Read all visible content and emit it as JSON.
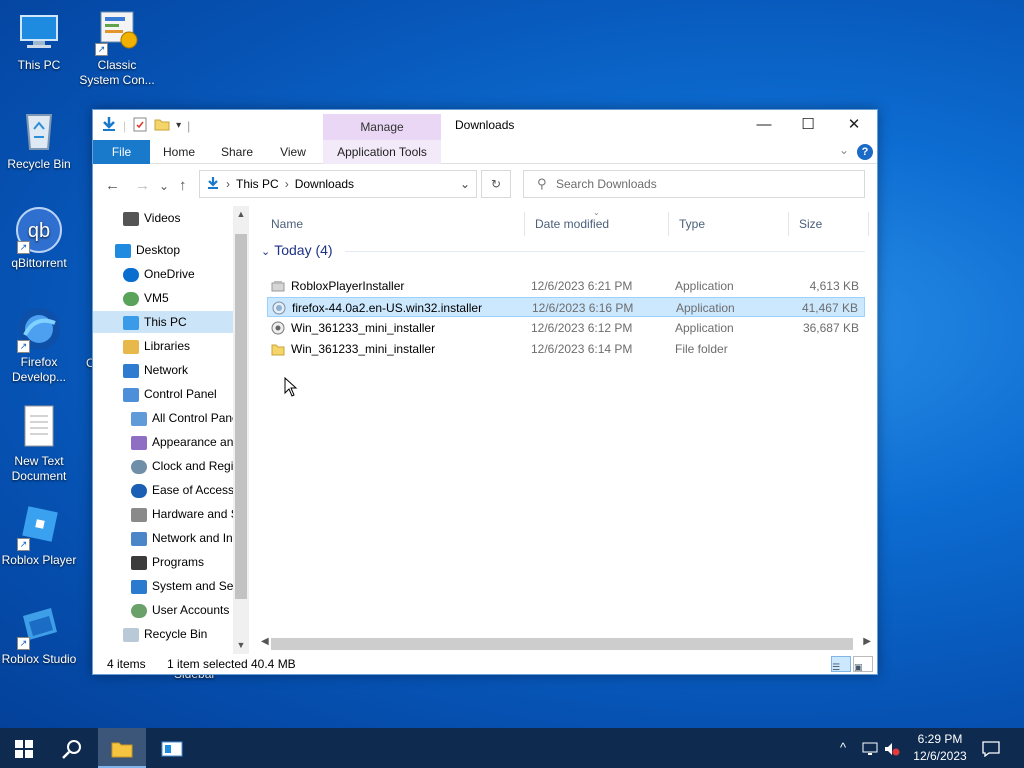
{
  "desktop": {
    "icons": [
      {
        "label": "This PC"
      },
      {
        "label": "Classic System Con..."
      },
      {
        "label": "Recycle Bin"
      },
      {
        "label": "qBittorrent"
      },
      {
        "label": "Firefox Develop..."
      },
      {
        "label": "New Text Document"
      },
      {
        "label": "Roblox Player"
      },
      {
        "label": "Roblox Studio"
      }
    ],
    "partial_label_1": "C",
    "partial_label_2": "Sidebar"
  },
  "window": {
    "title": "Downloads",
    "manage_tab": "Manage",
    "ribbon_tabs": {
      "file": "File",
      "home": "Home",
      "share": "Share",
      "view": "View",
      "app_tools": "Application Tools"
    },
    "address": {
      "crumb1": "This PC",
      "crumb2": "Downloads"
    },
    "search_placeholder": "Search Downloads",
    "nav_pane": [
      {
        "label": "Videos"
      },
      {
        "label": "Desktop"
      },
      {
        "label": "OneDrive"
      },
      {
        "label": "VM5"
      },
      {
        "label": "This PC"
      },
      {
        "label": "Libraries"
      },
      {
        "label": "Network"
      },
      {
        "label": "Control Panel"
      },
      {
        "label": "All Control Panel Items"
      },
      {
        "label": "Appearance and Personalization"
      },
      {
        "label": "Clock and Region"
      },
      {
        "label": "Ease of Access"
      },
      {
        "label": "Hardware and Sound"
      },
      {
        "label": "Network and Internet"
      },
      {
        "label": "Programs"
      },
      {
        "label": "System and Security"
      },
      {
        "label": "User Accounts"
      },
      {
        "label": "Recycle Bin"
      }
    ],
    "columns": {
      "name": "Name",
      "date": "Date modified",
      "type": "Type",
      "size": "Size"
    },
    "group_header": "Today (4)",
    "files": [
      {
        "name": "RobloxPlayerInstaller",
        "date": "12/6/2023 6:21 PM",
        "type": "Application",
        "size": "4,613 KB"
      },
      {
        "name": "firefox-44.0a2.en-US.win32.installer",
        "date": "12/6/2023 6:16 PM",
        "type": "Application",
        "size": "41,467 KB"
      },
      {
        "name": "Win_361233_mini_installer",
        "date": "12/6/2023 6:12 PM",
        "type": "Application",
        "size": "36,687 KB"
      },
      {
        "name": "Win_361233_mini_installer",
        "date": "12/6/2023 6:14 PM",
        "type": "File folder",
        "size": ""
      }
    ],
    "status": {
      "items": "4 items",
      "selected": "1 item selected",
      "size": "40.4 MB"
    }
  },
  "taskbar": {
    "time": "6:29 PM",
    "date": "12/6/2023"
  },
  "colors": {
    "accent": "#1979ca",
    "selection": "#cce8ff",
    "taskbar": "#0e2a4f"
  }
}
